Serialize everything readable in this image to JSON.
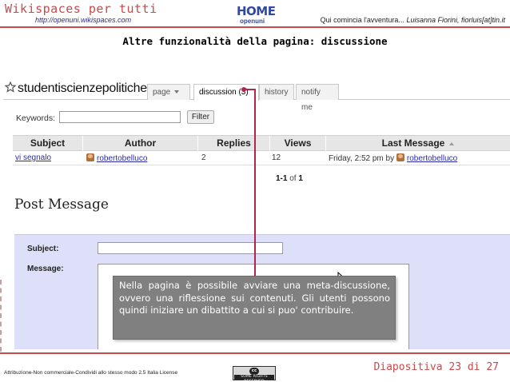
{
  "slide": {
    "title": "Wikispaces per tutti",
    "url": "http://openuni.wikispaces.com",
    "logo": {
      "home": "HOME",
      "openuni": "openuni"
    },
    "tagline": "Qui comincia l'avventura...",
    "authors": "Luisanna Fiorini, fiorluis[at]tin.it",
    "heading": "Altre funzionalità della pagina: discussione",
    "license": "Attribuzione-Non commerciale-Condividi allo stesso modo 2.5 Italia License",
    "cc_badge": {
      "symbol": "cc",
      "text": "SOME RIGHTS RESERVED"
    },
    "slide_number": "Diapositiva 23 di 27"
  },
  "wiki": {
    "space_name": "studentiscienzepolitiche",
    "tabs": [
      {
        "label": "page"
      },
      {
        "label": "discussion (3)"
      },
      {
        "label": "history"
      },
      {
        "label": "notify me"
      }
    ],
    "active_tab": "discussion (3)",
    "keywords_label": "Keywords:",
    "keywords_value": "",
    "filter_label": "Filter",
    "table": {
      "columns": [
        "Subject",
        "Author",
        "Replies",
        "Views",
        "Last Message"
      ],
      "rows": [
        {
          "subject": "vi segnalo",
          "author": "robertobelluco",
          "replies": "2",
          "views": "12",
          "last_when": "Friday, 2:52 pm by",
          "last_user": "robertobelluco"
        }
      ]
    },
    "pagination": {
      "range": "1-1",
      "of": "of",
      "total": "1"
    },
    "post_heading": "Post Message",
    "subject_label": "Subject:",
    "message_label": "Message:"
  },
  "annotation": {
    "text": "Nella pagina è possibile avviare una meta-discussione, ovvero una riflessione sui contenuti. Gli utenti possono quindi iniziare un dibattito a cui si puo' contribuire.",
    "color": "#b1264a"
  },
  "colors": {
    "accent": "#c84a4a",
    "link": "#2a2aa8",
    "post_area": "#dde0f8"
  },
  "icons": [
    "star-icon",
    "page-caret-icon",
    "sort-arrow-icon",
    "avatar-icon",
    "mouse-cursor-icon"
  ]
}
